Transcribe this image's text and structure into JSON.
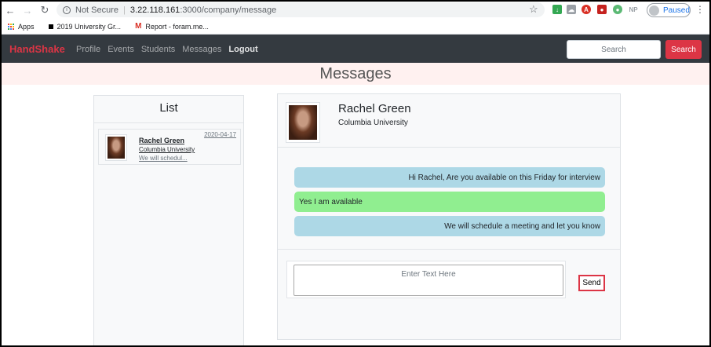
{
  "browser": {
    "security_label": "Not Secure",
    "url_host": "3.22.118.161",
    "url_path": ":3000/company/message",
    "profile_status": "Paused",
    "bookmarks": [
      {
        "label": "Apps"
      },
      {
        "label": "2019 University Gr..."
      },
      {
        "label": "Report - foram.me..."
      }
    ]
  },
  "navbar": {
    "brand": "HandShake",
    "links": [
      "Profile",
      "Events",
      "Students",
      "Messages",
      "Logout"
    ],
    "search_placeholder": "Search",
    "search_button": "Search"
  },
  "page": {
    "title": "Messages"
  },
  "list": {
    "title": "List",
    "items": [
      {
        "name": "Rachel Green",
        "school": "Columbia University",
        "preview": "We will schedul...",
        "date": "2020-04-17"
      }
    ]
  },
  "conversation": {
    "name": "Rachel Green",
    "school": "Columbia University",
    "messages": [
      {
        "direction": "sent",
        "text": "Hi Rachel, Are you available on this Friday for interview"
      },
      {
        "direction": "received",
        "text": "Yes I am available"
      },
      {
        "direction": "sent",
        "text": "We will schedule a meeting and let you know"
      }
    ],
    "compose_placeholder": "Enter Text Here",
    "send_label": "Send"
  },
  "colors": {
    "navbar_bg": "#343a40",
    "brand": "#dc3545",
    "sent_bubble": "#add8e6",
    "received_bubble": "#90ee90",
    "banner_bg": "#fff1f0"
  }
}
